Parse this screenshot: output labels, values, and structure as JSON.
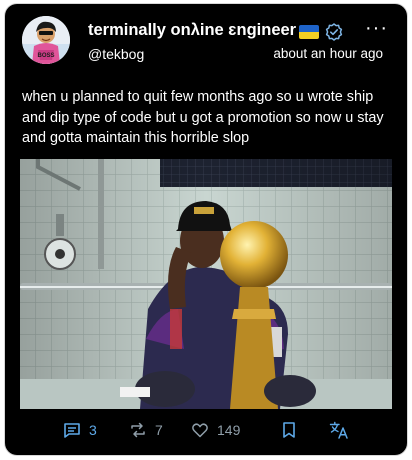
{
  "author": {
    "display_name": "terminally onλine ɛngineer",
    "handle": "@tekbog",
    "avatar_text": "BOSS",
    "badges": [
      "ukraine-flag-icon",
      "verified-badge-icon"
    ]
  },
  "post": {
    "timestamp": "about an hour ago",
    "text": "when u planned to quit few months ago so u wrote ship and dip type of code but u got a promotion so now u stay and gotta maintain this horrible slop"
  },
  "actions": {
    "replies": "3",
    "reposts": "7",
    "likes": "149"
  },
  "icons": [
    "more-options-icon",
    "reply-icon",
    "repost-icon",
    "like-icon",
    "bookmark-icon",
    "translate-icon"
  ],
  "colors": {
    "background": "#000000",
    "text": "#ffffff",
    "accent": "#5ea9e8",
    "muted": "#8f9ea9",
    "verified": "#7fb6e6"
  }
}
